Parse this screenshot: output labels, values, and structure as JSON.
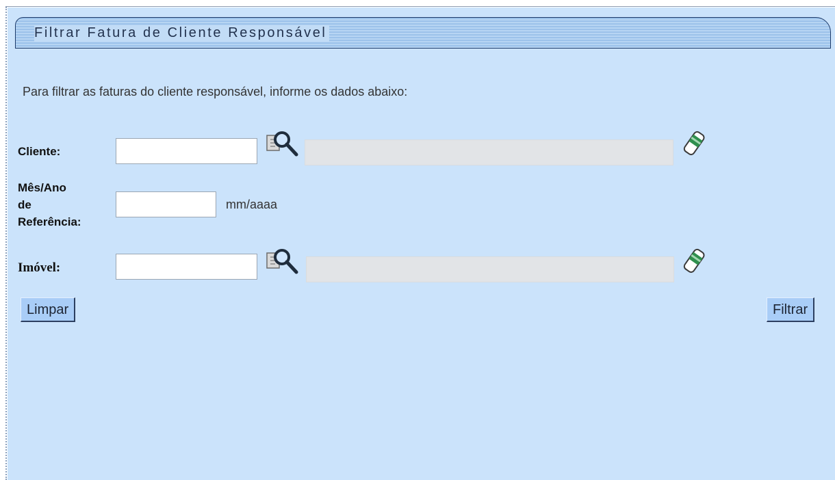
{
  "panel": {
    "title": "Filtrar Fatura de Cliente Responsável",
    "intro": "Para filtrar as faturas do cliente responsável, informe os dados abaixo:"
  },
  "form": {
    "cliente": {
      "label": "Cliente:",
      "value": "",
      "name_value": "",
      "search_icon": "magnifier-document-icon",
      "clear_icon": "eraser-icon"
    },
    "referencia": {
      "label_line1": "Mês/Ano",
      "label_line2": "de",
      "label_line3": "Referência:",
      "value": "",
      "unit": "mm/aaaa"
    },
    "imovel": {
      "label": "Imóvel:",
      "value": "",
      "name_value": "",
      "search_icon": "magnifier-document-icon",
      "clear_icon": "eraser-icon"
    }
  },
  "buttons": {
    "limpar": "Limpar",
    "filtrar": "Filtrar"
  },
  "colors": {
    "panel_bg": "#cbe3fb",
    "button_bg": "#a9cdf7",
    "readonly_bg": "#e2e4e7"
  }
}
